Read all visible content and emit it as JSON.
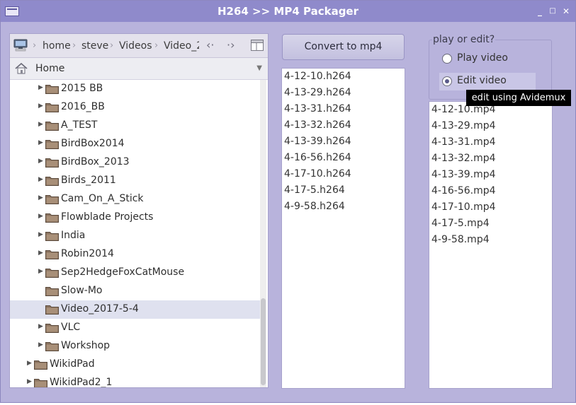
{
  "window": {
    "title": "H264 >> MP4 Packager"
  },
  "chooser": {
    "path": [
      "home",
      "steve",
      "Videos",
      "Video_2"
    ],
    "location": "Home",
    "tree": [
      {
        "name": "2015 BB",
        "depth": 2,
        "expander": true,
        "selected": false
      },
      {
        "name": "2016_BB",
        "depth": 2,
        "expander": true,
        "selected": false
      },
      {
        "name": "A_TEST",
        "depth": 2,
        "expander": true,
        "selected": false
      },
      {
        "name": "BirdBox2014",
        "depth": 2,
        "expander": true,
        "selected": false
      },
      {
        "name": "BirdBox_2013",
        "depth": 2,
        "expander": true,
        "selected": false
      },
      {
        "name": "Birds_2011",
        "depth": 2,
        "expander": true,
        "selected": false
      },
      {
        "name": "Cam_On_A_Stick",
        "depth": 2,
        "expander": true,
        "selected": false
      },
      {
        "name": "Flowblade Projects",
        "depth": 2,
        "expander": true,
        "selected": false
      },
      {
        "name": "India",
        "depth": 2,
        "expander": true,
        "selected": false
      },
      {
        "name": "Robin2014",
        "depth": 2,
        "expander": true,
        "selected": false
      },
      {
        "name": "Sep2HedgeFoxCatMouse",
        "depth": 2,
        "expander": true,
        "selected": false
      },
      {
        "name": "Slow-Mo",
        "depth": 2,
        "expander": false,
        "selected": false
      },
      {
        "name": "Video_2017-5-4",
        "depth": 2,
        "expander": false,
        "selected": true
      },
      {
        "name": "VLC",
        "depth": 2,
        "expander": true,
        "selected": false
      },
      {
        "name": "Workshop",
        "depth": 2,
        "expander": true,
        "selected": false
      },
      {
        "name": "WikidPad",
        "depth": 1,
        "expander": true,
        "selected": false
      },
      {
        "name": "WikidPad2_1",
        "depth": 1,
        "expander": true,
        "selected": false
      }
    ]
  },
  "convert_label": "Convert to mp4",
  "h264_files": [
    "4-12-10.h264",
    "4-13-29.h264",
    "4-13-31.h264",
    "4-13-32.h264",
    "4-13-39.h264",
    "4-16-56.h264",
    "4-17-10.h264",
    "4-17-5.h264",
    "4-9-58.h264"
  ],
  "mode": {
    "title": "play or edit?",
    "play_label": "Play video",
    "edit_label": "Edit video",
    "selected": "edit",
    "tooltip": "edit using Avidemux"
  },
  "mp4_files": [
    "4-12-10.mp4",
    "4-13-29.mp4",
    "4-13-31.mp4",
    "4-13-32.mp4",
    "4-13-39.mp4",
    "4-16-56.mp4",
    "4-17-10.mp4",
    "4-17-5.mp4",
    "4-9-58.mp4"
  ],
  "icons": {
    "folder": "folder-icon",
    "computer": "computer-icon",
    "home": "home-icon"
  },
  "colors": {
    "window_bg": "#b8b3dc",
    "titlebar": "#8f8acb",
    "selection": "#dfe1ef"
  }
}
